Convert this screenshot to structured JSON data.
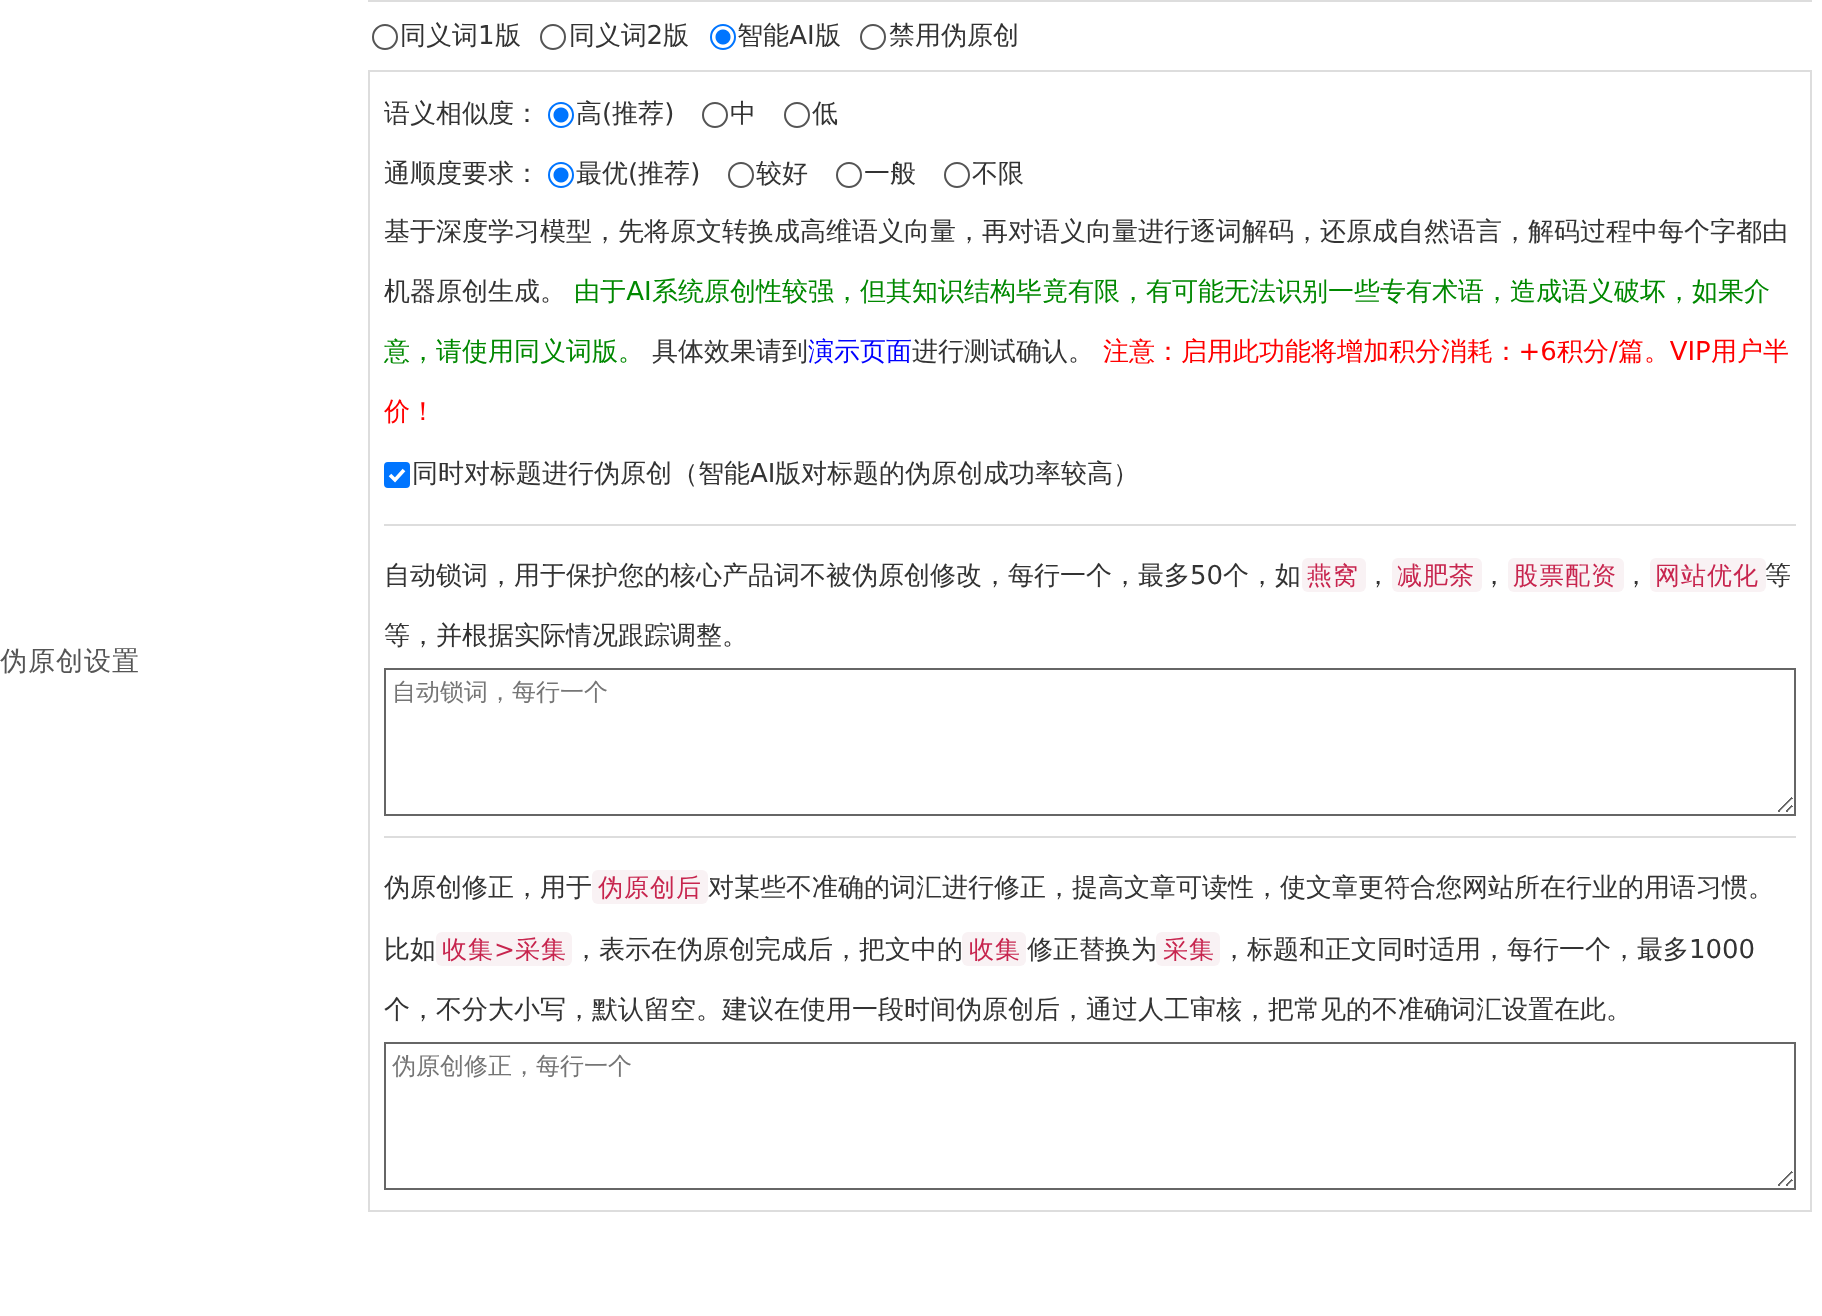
{
  "side_label": "伪原创设置",
  "modes": [
    {
      "label": "同义词1版",
      "selected": false
    },
    {
      "label": "同义词2版",
      "selected": false
    },
    {
      "label": "智能AI版",
      "selected": true
    },
    {
      "label": "禁用伪原创",
      "selected": false
    }
  ],
  "option_groups": [
    {
      "label": "语义相似度：",
      "options": [
        {
          "label": "高(推荐)",
          "selected": true
        },
        {
          "label": "中",
          "selected": false
        },
        {
          "label": "低",
          "selected": false
        }
      ]
    },
    {
      "label": "通顺度要求：",
      "options": [
        {
          "label": "最优(推荐)",
          "selected": true
        },
        {
          "label": "较好",
          "selected": false
        },
        {
          "label": "一般",
          "selected": false
        },
        {
          "label": "不限",
          "selected": false
        }
      ]
    }
  ],
  "description": [
    {
      "kind": "plain",
      "text": "基于深度学习模型，先将原文转换成高维语义向量，再对语义向量进行逐词解码，还原成自然语言，解码过程中每个字都由机器原创生成。 "
    },
    {
      "kind": "green",
      "text": "由于AI系统原创性较强，但其知识结构毕竟有限，有可能无法识别一些专有术语，造成语义破坏，如果介意，请使用同义词版。"
    },
    {
      "kind": "plain",
      "text": " 具体效果请到"
    },
    {
      "kind": "link",
      "text": "演示页面"
    },
    {
      "kind": "plain",
      "text": "进行测试确认。 "
    },
    {
      "kind": "red",
      "text": "注意：启用此功能将增加积分消耗：+6积分/篇。VIP用户半价！"
    }
  ],
  "title_option": {
    "label": "同时对标题进行伪原创（智能AI版对标题的伪原创成功率较高）",
    "checked": true
  },
  "sections": [
    {
      "text": [
        {
          "kind": "plain",
          "text": "自动锁词，用于保护您的核心产品词不被伪原创修改，每行一个，最多50个，如"
        },
        {
          "kind": "code",
          "text": "燕窝"
        },
        {
          "kind": "plain",
          "text": "，"
        },
        {
          "kind": "code",
          "text": "减肥茶"
        },
        {
          "kind": "plain",
          "text": "，"
        },
        {
          "kind": "code",
          "text": "股票配资"
        },
        {
          "kind": "plain",
          "text": "，"
        },
        {
          "kind": "code",
          "text": "网站优化"
        },
        {
          "kind": "plain",
          "text": "等等，并根据实际情况跟踪调整。"
        }
      ],
      "placeholder": "自动锁词，每行一个"
    },
    {
      "text": [
        {
          "kind": "plain",
          "text": "伪原创修正，用于"
        },
        {
          "kind": "code",
          "text": "伪原创后"
        },
        {
          "kind": "plain",
          "text": "对某些不准确的词汇进行修正，提高文章可读性，使文章更符合您网站所在行业的用语习惯。比如"
        },
        {
          "kind": "code",
          "text": "收集>采集"
        },
        {
          "kind": "plain",
          "text": "，表示在伪原创完成后，把文中的"
        },
        {
          "kind": "code",
          "text": "收集"
        },
        {
          "kind": "plain",
          "text": "修正替换为"
        },
        {
          "kind": "code",
          "text": "采集"
        },
        {
          "kind": "plain",
          "text": "，标题和正文同时适用，每行一个，最多1000个，不分大小写，默认留空。建议在使用一段时间伪原创后，通过人工审核，把常见的不准确词汇设置在此。"
        }
      ],
      "placeholder": "伪原创修正，每行一个"
    }
  ]
}
